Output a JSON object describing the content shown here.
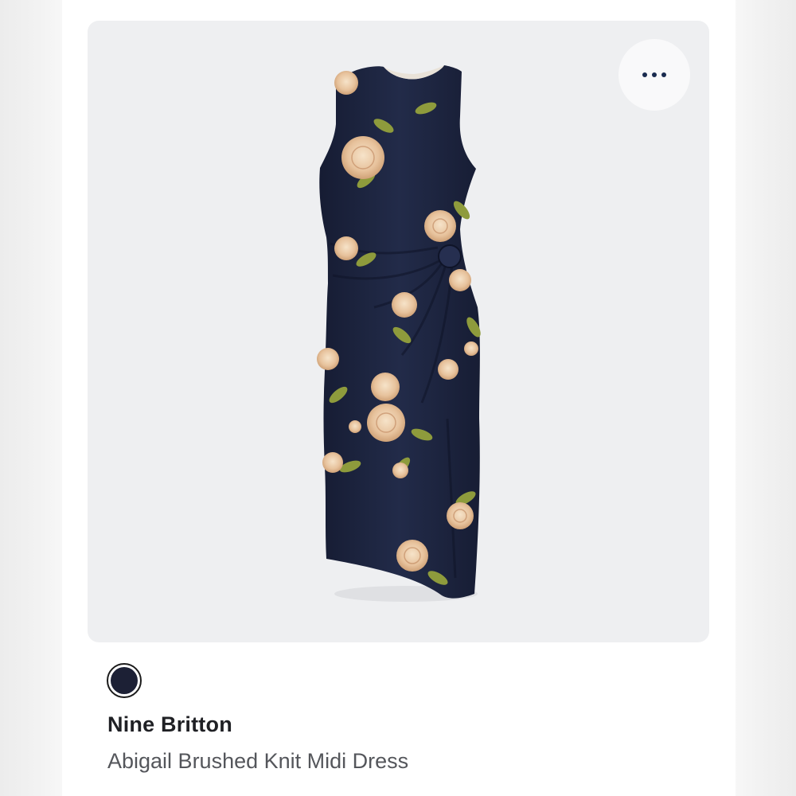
{
  "product": {
    "brand": "Nine Britton",
    "name": "Abigail Brushed Knit Midi Dress",
    "image_alt": "Navy floral sleeveless midi dress with side twist",
    "swatch_color": "#1c2035"
  },
  "colors": {
    "dress_navy": "#1d2540",
    "flower_blush": "#e9c9a6",
    "leaf_olive": "#8a9a3a"
  },
  "actions": {
    "more_icon": "more-horizontal-icon"
  }
}
